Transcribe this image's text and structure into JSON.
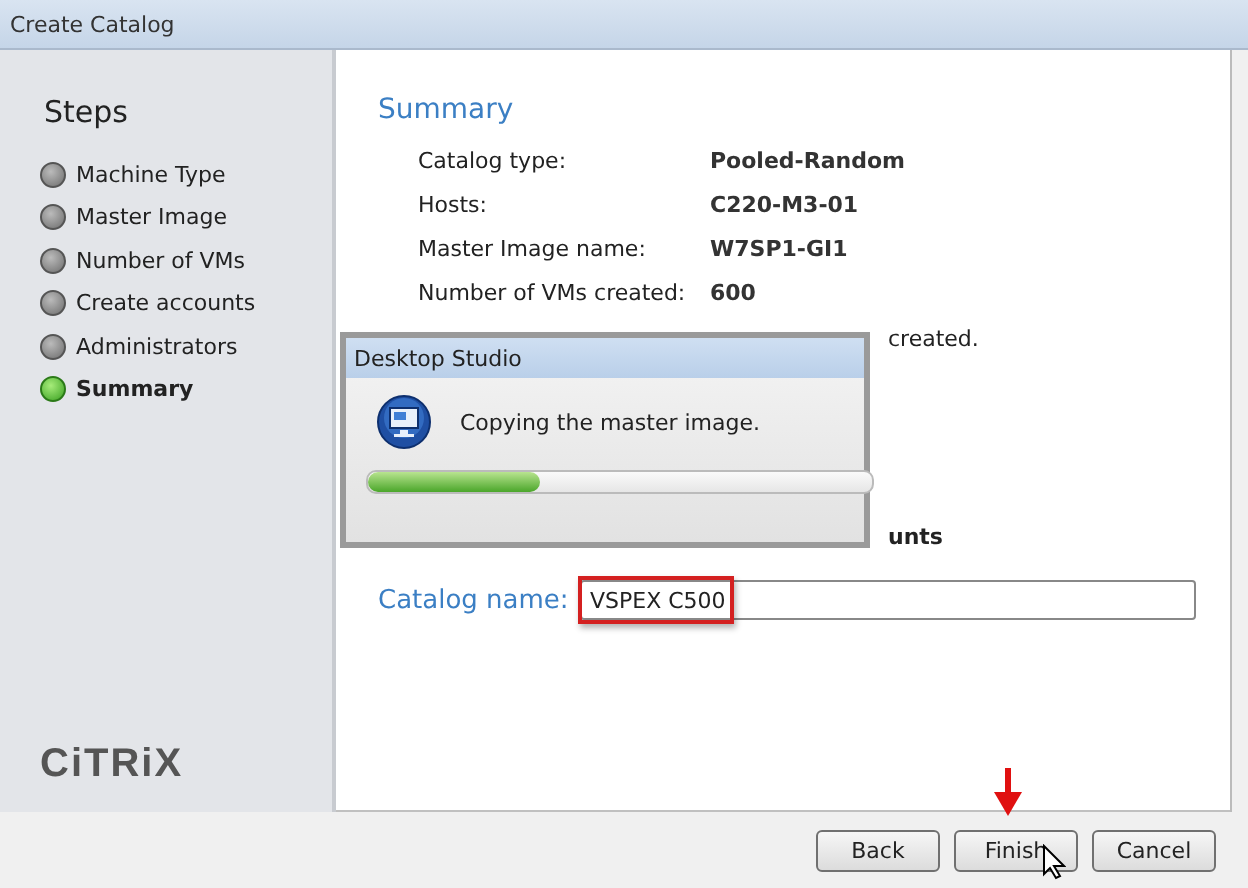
{
  "window": {
    "title": "Create Catalog"
  },
  "sidebar": {
    "heading": "Steps",
    "logo": "CiTRiX",
    "steps": [
      {
        "label": "Machine Type",
        "selected": false
      },
      {
        "label": "Master Image",
        "selected": false
      },
      {
        "label": "Number of VMs",
        "selected": false
      },
      {
        "label": "Create accounts",
        "selected": false
      },
      {
        "label": "Administrators",
        "selected": false
      },
      {
        "label": "Summary",
        "selected": true
      }
    ]
  },
  "summary": {
    "heading": "Summary",
    "rows": [
      {
        "label": "Catalog type:",
        "value": "Pooled-Random"
      },
      {
        "label": "Hosts:",
        "value": "C220-M3-01"
      },
      {
        "label": "Master Image name:",
        "value": "W7SP1-GI1"
      },
      {
        "label": "Number of VMs created:",
        "value": "600"
      }
    ],
    "partial_texts": [
      {
        "text": "created.",
        "bold": false
      },
      {
        "text": "unts",
        "bold": true
      }
    ]
  },
  "catalog_name": {
    "label": "Catalog name:",
    "value": "VSPEX C500"
  },
  "progress_dialog": {
    "title": "Desktop Studio",
    "message": "Copying the master image.",
    "level": 0.34
  },
  "buttons": [
    "Back",
    "Finish",
    "Cancel"
  ]
}
